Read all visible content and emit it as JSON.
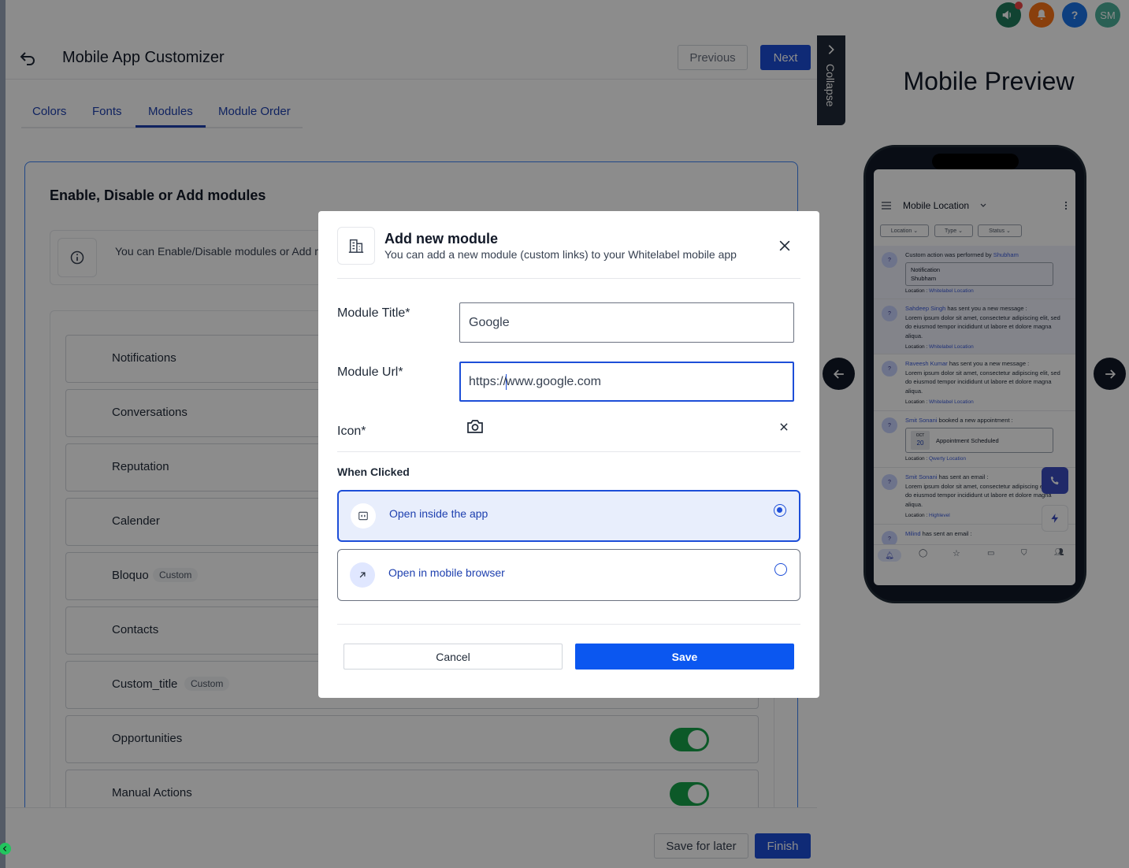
{
  "topbar": {
    "avatar_initials": "SM",
    "help_label": "?",
    "colors": {
      "announce": "#1f7a5c",
      "bell": "#f97316",
      "help": "#1a73e8",
      "avatar": "#4caf9a"
    }
  },
  "header": {
    "title": "Mobile App Customizer",
    "previous_label": "Previous",
    "next_label": "Next"
  },
  "tabs": [
    {
      "label": "Colors",
      "active": false
    },
    {
      "label": "Fonts",
      "active": false
    },
    {
      "label": "Modules",
      "active": true
    },
    {
      "label": "Module Order",
      "active": false
    }
  ],
  "modules_card": {
    "title": "Enable, Disable or Add modules",
    "info_text": "You can Enable/Disable modules or Add modules in your mobile app",
    "items": [
      {
        "label": "Notifications",
        "badge": ""
      },
      {
        "label": "Conversations",
        "badge": ""
      },
      {
        "label": "Reputation",
        "badge": ""
      },
      {
        "label": "Calender",
        "badge": ""
      },
      {
        "label": "Bloquo",
        "badge": "Custom"
      },
      {
        "label": "Contacts",
        "badge": ""
      },
      {
        "label": "Custom_title",
        "badge": "Custom"
      },
      {
        "label": "Opportunities",
        "badge": "",
        "enabled": true
      },
      {
        "label": "Manual Actions",
        "badge": "",
        "enabled": true
      }
    ]
  },
  "footer": {
    "save_later_label": "Save for later",
    "finish_label": "Finish"
  },
  "preview": {
    "collapse_label": "Collapse",
    "title": "Mobile Preview",
    "phone": {
      "location_title": "Mobile Location",
      "filters": [
        "Location",
        "Type",
        "Status"
      ],
      "feed": [
        {
          "pre": "Custom action was performed by ",
          "name": "Shubham",
          "box": [
            "Notification",
            "Shubham"
          ],
          "location_label": "Location : ",
          "location": "Whitelabel Location"
        },
        {
          "name": "Sahdeep Singh",
          "text": " has sent you a new message :",
          "body": "Lorem ipsum dolor sit amet, consectetur adipiscing elit, sed do eiusmod tempor incididunt ut labore et dolore magna aliqua.",
          "location_label": "Location : ",
          "location": "Whitelabel Location"
        },
        {
          "name": "Raveesh Kumar",
          "text": " has sent you a new message :",
          "body": "Lorem ipsum dolor sit amet, consectetur adipiscing elit, sed do eiusmod tempor incididunt ut labore et dolore magna aliqua.",
          "location_label": "Location : ",
          "location": "Whitelabel Location"
        },
        {
          "name": "Smit Sonani",
          "text": " booked a new appointment :",
          "date_month": "OCT",
          "date_day": "20",
          "appt": "Appointment Scheduled",
          "location_label": "Location : ",
          "location": "Qwerty Location"
        },
        {
          "name": "Smit Sonani",
          "text": " has sent an email :",
          "body": "Lorem ipsum dolor sit amet, consectetur adipiscing elit, sed do eiusmod tempor incididunt ut labore et dolore magna aliqua.",
          "location_label": "Location : ",
          "location": "Highlevel"
        },
        {
          "name": "Milind",
          "text": " has sent an email :"
        }
      ]
    }
  },
  "modal": {
    "title": "Add new module",
    "subtitle": "You can add a new module (custom links) to your Whitelabel mobile app",
    "fields": {
      "title_label": "Module Title*",
      "title_value": "Google",
      "url_label": "Module Url*",
      "url_value_before_caret": "https://",
      "url_value_after_caret": "www.google.com",
      "icon_label": "Icon*"
    },
    "when_clicked_label": "When Clicked",
    "options": [
      {
        "label": "Open inside the app",
        "selected": true
      },
      {
        "label": "Open in mobile browser",
        "selected": false
      }
    ],
    "cancel_label": "Cancel",
    "save_label": "Save"
  }
}
